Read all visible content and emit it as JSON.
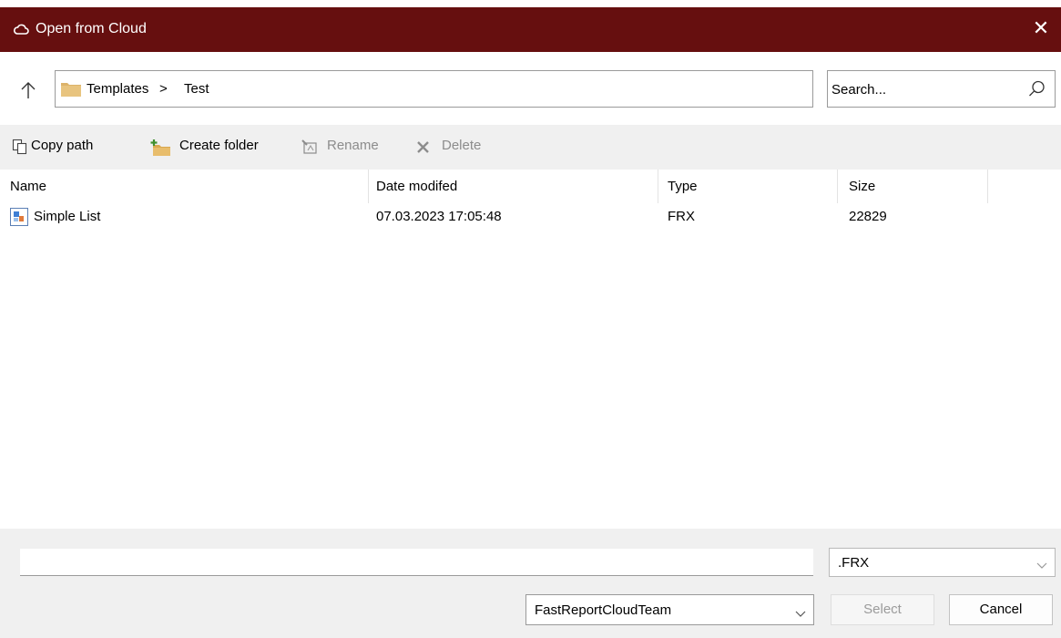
{
  "window": {
    "title": "Open from Cloud",
    "close_glyph": "✕",
    "title_icon": "cloud-icon",
    "accent": "#660f0f"
  },
  "nav": {
    "up_icon": "arrow-up-icon",
    "breadcrumb": [
      "Templates",
      "Test"
    ],
    "breadcrumb_separator": ">",
    "search_placeholder": "Search..."
  },
  "toolbar": {
    "copy_path": "Copy path",
    "create_folder": "Create folder",
    "rename": "Rename",
    "delete": "Delete"
  },
  "file_list": {
    "columns": [
      "Name",
      "Date modifed",
      "Type",
      "Size"
    ],
    "rows": [
      {
        "name": "Simple List",
        "date": "07.03.2023 17:05:48",
        "type": "FRX",
        "size": "22829"
      }
    ]
  },
  "footer": {
    "filename_value": "",
    "filter_selected": ".FRX",
    "workspace_selected": "FastReportCloudTeam",
    "select_label": "Select",
    "cancel_label": "Cancel"
  }
}
